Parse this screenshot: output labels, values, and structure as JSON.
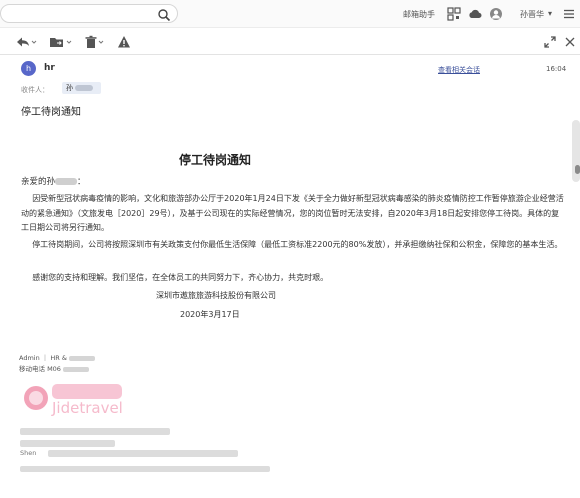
{
  "topbar": {
    "search_placeholder": "",
    "mail_assistant": "邮箱助手",
    "search_icon": "search-icon",
    "user_name": "孙晋华"
  },
  "toolbar": {
    "reply_icon": "reply-icon",
    "move_icon": "move-folder-icon",
    "delete_icon": "trash-icon",
    "report_icon": "warning-icon",
    "expand_icon": "expand-icon",
    "close_icon": "close-icon"
  },
  "message": {
    "avatar_letter": "h",
    "sender": "hr",
    "view_conversation": "查看相关会话",
    "time": "16:04",
    "to_label": "收件人：",
    "to_name": "孙",
    "subject": "停工待岗通知"
  },
  "letter": {
    "title": "停工待岗通知",
    "greeting_prefix": "亲爱的孙",
    "greeting_suffix": "：",
    "paragraph1": "因受新型冠状病毒疫情的影响，文化和旅游部办公厅于2020年1月24日下发《关于全力做好新型冠状病毒感染的肺炎疫情防控工作暂停旅游企业经营活动的紧急通知》（文旅发电［2020］29号），及基于公司现在的实际经营情况，您的岗位暂时无法安排，自2020年3月18日起安排您停工待岗。具体的复工日期公司将另行通知。",
    "paragraph2": "停工待岗期间，公司将按照深圳市有关政策支付你最低生活保障（最低工资标准2200元的80%发放），并承担缴纳社保和公积金，保障您的基本生活。",
    "paragraph3": "感谢您的支持和理解。我们坚信，在全体员工的共同努力下，齐心协力，共克时艰。",
    "company": "深圳市遨旅旅游科技股份有限公司",
    "date": "2020年3月17日"
  },
  "signature": {
    "line1": "Admin ｜ HR  &",
    "line2": "移动电话 M06",
    "logo_text": "Jidetravel",
    "address_fragment": "Shen"
  },
  "colors": {
    "avatar": "#5867c9",
    "link": "#3a4f9a",
    "logo_pink": "#e8577e"
  }
}
